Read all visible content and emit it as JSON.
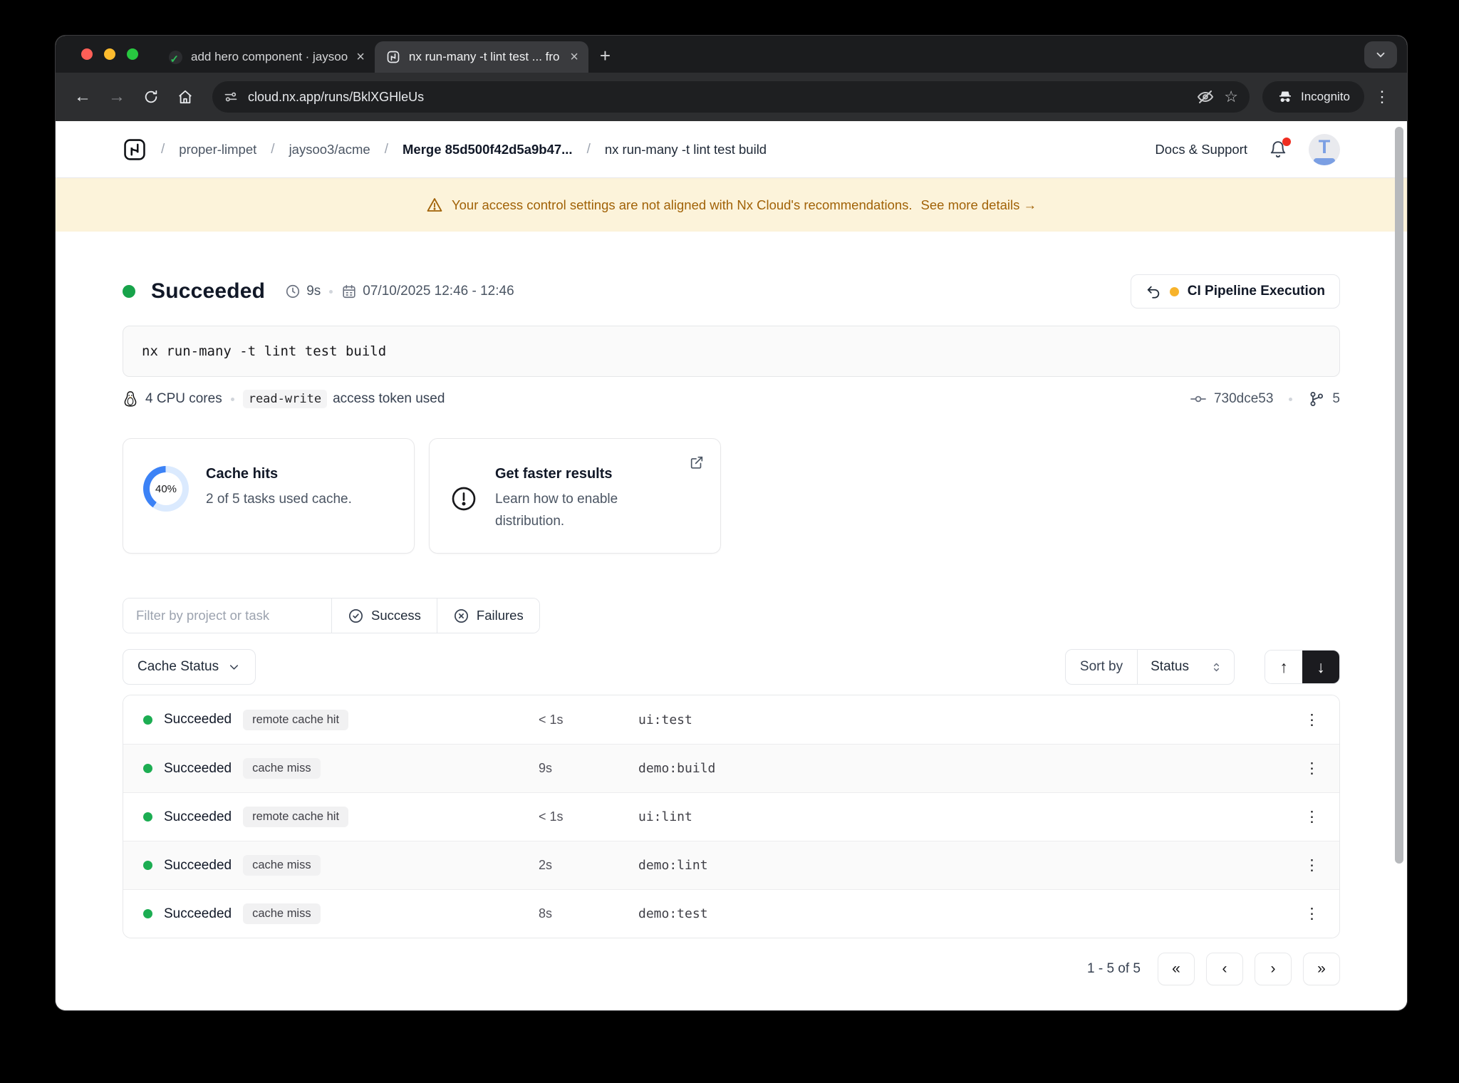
{
  "colors": {
    "success_green": "#17a34a",
    "accent_blue": "#3c82f6",
    "donut_track": "#dbeafe",
    "warning_bg": "#fcf3da",
    "warning_text": "#a16207",
    "pending_amber": "#f7b32b",
    "notification_red": "#ef2d20",
    "active_sort_bg": "#1b1b1f"
  },
  "glyphs": {
    "close_tab": "×",
    "new_tab": "+",
    "back": "←",
    "forward": "→",
    "star": "☆",
    "kebab": "⋮",
    "arrow_up": "↑",
    "arrow_down": "↓",
    "first": "«",
    "prev": "‹",
    "next": "›",
    "last": "»",
    "pr_check": "✓"
  },
  "chrome": {
    "tabs": [
      {
        "title": "add hero component · jaysoo"
      },
      {
        "title": "nx run-many -t lint test ... fro"
      }
    ],
    "url": "cloud.nx.app/runs/BklXGHleUs",
    "incognito_label": "Incognito"
  },
  "header": {
    "breadcrumbs": [
      "proper-limpet",
      "jaysoo3/acme",
      "Merge 85d500f42d5a9b47...",
      "nx run-many -t lint test build"
    ],
    "separator": "/",
    "docs_support": "Docs & Support",
    "avatar_letter": "T"
  },
  "banner": {
    "text": "Your access control settings are not aligned with Nx Cloud's recommendations.",
    "link": "See more details →"
  },
  "run": {
    "status": "Succeeded",
    "duration": "9s",
    "date_range": "07/10/2025 12:46 - 12:46",
    "pipeline_button": "CI Pipeline Execution",
    "command": "nx run-many -t lint test build",
    "cpu": "4 CPU cores",
    "token_badge": "read-write",
    "token_suffix": "access token used",
    "commit": "730dce53",
    "branch_count": "5"
  },
  "cards": {
    "cache": {
      "percent": "40%",
      "title": "Cache hits",
      "subtitle": "2 of 5 tasks used cache."
    },
    "faster": {
      "title": "Get faster results",
      "subtitle": "Learn how to enable distribution."
    }
  },
  "filters": {
    "placeholder": "Filter by project or task",
    "success": "Success",
    "failures": "Failures",
    "cache_status": "Cache Status",
    "sort_by": "Sort by",
    "sort_value": "Status"
  },
  "table": {
    "rows": [
      {
        "status": "Succeeded",
        "badge": "remote cache hit",
        "duration": "< 1s",
        "task": "ui:test"
      },
      {
        "status": "Succeeded",
        "badge": "cache miss",
        "duration": "9s",
        "task": "demo:build"
      },
      {
        "status": "Succeeded",
        "badge": "remote cache hit",
        "duration": "< 1s",
        "task": "ui:lint"
      },
      {
        "status": "Succeeded",
        "badge": "cache miss",
        "duration": "2s",
        "task": "demo:lint"
      },
      {
        "status": "Succeeded",
        "badge": "cache miss",
        "duration": "8s",
        "task": "demo:test"
      }
    ]
  },
  "pagination": {
    "label": "1 - 5 of 5"
  }
}
